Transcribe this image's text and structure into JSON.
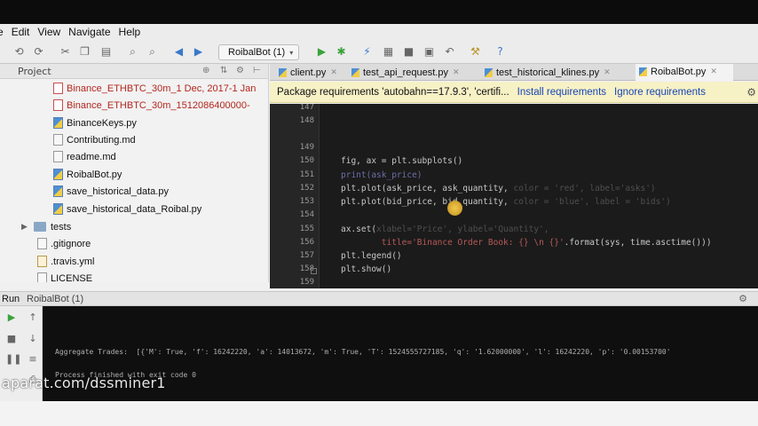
{
  "menu": {
    "items": [
      "e",
      "Edit",
      "View",
      "Navigate",
      "Help"
    ]
  },
  "toolbar": {
    "run_config": "RoibalBot (1)",
    "icons": [
      "back-icon",
      "forward-icon",
      "cut-icon",
      "copy-icon",
      "paste-icon",
      "find-icon",
      "replace-icon",
      "nav-back-icon",
      "nav-forward-icon",
      "run-icon",
      "debug-icon",
      "profile-icon",
      "coverage-icon",
      "stop-icon",
      "vcs-icon",
      "settings-icon",
      "help-icon"
    ]
  },
  "project": {
    "title": "Project",
    "files": [
      {
        "name": "Binance_ETHBTC_30m_1 Dec, 2017-1 Jan",
        "type": "red"
      },
      {
        "name": "Binance_ETHBTC_30m_1512086400000-",
        "type": "red"
      },
      {
        "name": "BinanceKeys.py",
        "type": "py"
      },
      {
        "name": "Contributing.md",
        "type": "md"
      },
      {
        "name": "readme.md",
        "type": "md"
      },
      {
        "name": "RoibalBot.py",
        "type": "py"
      },
      {
        "name": "save_historical_data.py",
        "type": "py"
      },
      {
        "name": "save_historical_data_Roibal.py",
        "type": "py"
      }
    ],
    "tests_folder": "tests",
    "root_files": [
      {
        "name": ".gitignore",
        "type": "md"
      },
      {
        "name": ".travis.yml",
        "type": "yml"
      },
      {
        "name": "LICENSE",
        "type": "md"
      }
    ]
  },
  "tabs": [
    {
      "label": "client.py",
      "active": false
    },
    {
      "label": "test_api_request.py",
      "active": false
    },
    {
      "label": "test_historical_klines.py",
      "active": false
    },
    {
      "label": "RoibalBot.py",
      "active": true
    }
  ],
  "notice": {
    "text": "Package requirements 'autobahn==17.9.3', 'certifi...",
    "install": "Install requirements",
    "ignore": "Ignore requirements"
  },
  "editor": {
    "line_numbers": [
      "147",
      "148",
      "149",
      "150",
      "151",
      "152",
      "153",
      "154",
      "155",
      "156",
      "157",
      "158",
      "159"
    ],
    "lines": {
      "l150": "fig, ax = plt.subplots()",
      "l151": "print(ask_price)",
      "l152a": "plt.plot(ask_price, ask_quantity,",
      "l152b": "color = 'red', label='asks')",
      "l153a": "plt.plot(bid_price, bid_quantity,",
      "l153b": "color = 'blue', label = 'bids')",
      "l155a": "ax.set(",
      "l155b": "xlabel='Price', ylabel='Quantity',",
      "l156a": "title='Binance Order Book: {} \\n {}'",
      "l156b": ".format(sys, time.asctime()))",
      "l157": "plt.legend()",
      "l158": "plt.show()"
    }
  },
  "run": {
    "label": "Run",
    "config": "RoibalBot (1)",
    "output_line1": "Aggregate Trades:  [{'M': True, 'f': 16242220, 'a': 14013672, 'm': True, 'T': 1524555727185, 'q': '1.62000000', 'l': 16242220, 'p': '0.00153700'",
    "output_line2": "Process finished with exit code 0"
  },
  "watermark": "aparat.com/dssminer1"
}
